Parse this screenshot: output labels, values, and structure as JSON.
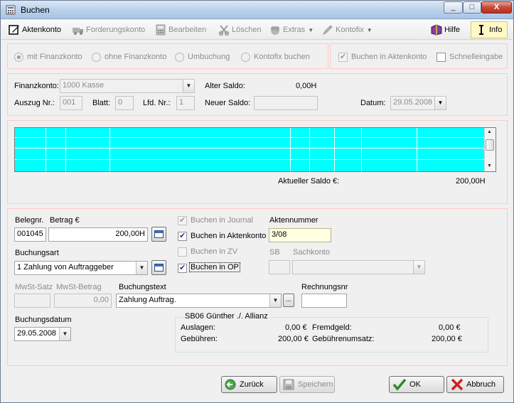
{
  "window": {
    "title": "Buchen",
    "controls": [
      "_",
      "□",
      "X"
    ]
  },
  "toolbar": {
    "items": [
      {
        "label": "Aktenkonto",
        "icon": "edit-icon",
        "enabled": true
      },
      {
        "label": "Forderungskonto",
        "icon": "truck-icon",
        "enabled": false
      },
      {
        "label": "Bearbeiten",
        "icon": "calculator-icon",
        "enabled": false
      },
      {
        "label": "Löschen",
        "icon": "scissors-icon",
        "enabled": false
      },
      {
        "label": "Extras",
        "icon": "extras-icon",
        "enabled": false
      },
      {
        "label": "Kontofix",
        "icon": "pen-icon",
        "enabled": false
      }
    ],
    "help_label": "Hilfe",
    "info_label": "Info"
  },
  "mode": {
    "options": [
      "mit Finanzkonto",
      "ohne Finanzkonto",
      "Umbuchung",
      "Kontofix buchen"
    ],
    "selected": "mit Finanzkonto",
    "buchen_in_aktenkonto": "Buchen in Aktenkonto",
    "schnelleingabe": "Schnelleingabe"
  },
  "finanz": {
    "konto_label": "Finanzkonto:",
    "konto_value": "1000 Kasse",
    "alter_saldo_label": "Alter Saldo:",
    "alter_saldo_value": "0,00H",
    "auszug_label": "Auszug Nr.:",
    "auszug_value": "001",
    "blatt_label": "Blatt:",
    "blatt_value": "0",
    "lfd_label": "Lfd. Nr.:",
    "lfd_value": "1",
    "neuer_saldo_label": "Neuer Saldo:",
    "neuer_saldo_value": "",
    "datum_label": "Datum:",
    "datum_value": "29.05.2008"
  },
  "grid": {
    "row_count": 3,
    "aktueller_saldo_label": "Aktueller Saldo €:",
    "aktueller_saldo_value": "200,00H",
    "colors": {
      "row_bg": "#00ffff"
    }
  },
  "entry": {
    "belegnr_label": "Belegnr.",
    "belegnr_value": "001045",
    "betrag_label": "Betrag €",
    "betrag_value": "200,00H",
    "buchungsart_label": "Buchungsart",
    "buchungsart_value": "1 Zahlung von Auftraggeber",
    "mwst_satz_label": "MwSt-Satz",
    "mwst_satz_value": "",
    "mwst_betrag_label": "MwSt-Betrag",
    "mwst_betrag_value": "0,00",
    "buchungstext_label": "Buchungstext",
    "buchungstext_value": "Zahlung Auftrag.",
    "ellipsis": "...",
    "rechnungsnr_label": "Rechnungsnr",
    "rechnungsnr_value": "",
    "buchungsdatum_label": "Buchungsdatum",
    "buchungsdatum_value": "29.05.2008",
    "buchen_journal": "Buchen in Journal",
    "buchen_aktenkonto": "Buchen in Aktenkonto",
    "buchen_zv": "Buchen in ZV",
    "buchen_op": "Buchen in OP",
    "aktennummer_label": "Aktennummer",
    "aktennummer_value": "3/08",
    "sb_label": "SB",
    "sachkonto_label": "Sachkonto"
  },
  "summary": {
    "title": "SB06 Günther ./. Allianz",
    "auslagen_label": "Auslagen:",
    "auslagen_value": "0,00 €",
    "gebuehren_label": "Gebühren:",
    "gebuehren_value": "200,00 €",
    "fremdgeld_label": "Fremdgeld:",
    "fremdgeld_value": "0,00 €",
    "gebuehrenumsatz_label": "Gebührenumsatz:",
    "gebuehrenumsatz_value": "200,00 €"
  },
  "buttons": {
    "zurueck": "Zurück",
    "speichern": "Speichern",
    "ok": "OK",
    "abbruch": "Abbruch"
  }
}
